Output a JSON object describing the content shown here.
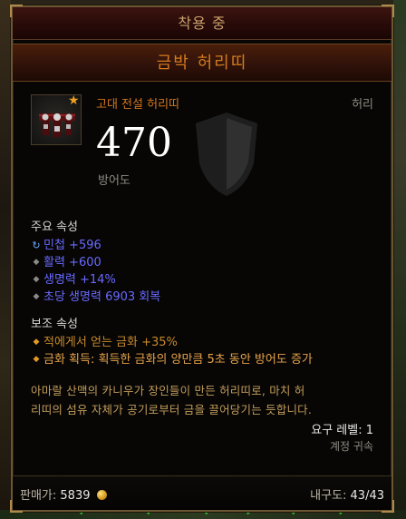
{
  "header": {
    "equipped_label": "착용 중",
    "item_name": "금박 허리띠"
  },
  "item": {
    "type_label": "고대 전설 허리띠",
    "slot_label": "허리",
    "armor_value": "470",
    "armor_label": "방어도",
    "icon": "belt-icon",
    "ancient_marker": "star-icon"
  },
  "primary": {
    "title": "주요 속성",
    "stats": [
      "민첩 +596",
      "활력 +600",
      "생명력 +14%",
      "초당 생명력 6903 회복"
    ]
  },
  "secondary": {
    "title": "보조 속성",
    "stats": [
      "적에게서 얻는 금화 +35%",
      "금화 획득: 획득한 금화의 양만큼 5초 동안 방어도 증가"
    ]
  },
  "flavor": {
    "line1": "아마랄 산맥의 카니우가 장인들이 만든 허리띠로, 마치 허",
    "line2": "리띠의 섬유 자체가 공기로부터 금을 끌어당기는 듯합니다."
  },
  "requirements": {
    "level": "요구 레벨: 1",
    "bind": "계정 귀속"
  },
  "footer": {
    "sell_label": "판매가:",
    "sell_value": "5839",
    "durability_label": "내구도:",
    "durability_value": "43/43"
  },
  "colors": {
    "legendary": "#d47a1e",
    "primary_stat": "#6969ff",
    "secondary_stat": "#c88a2a",
    "flavor": "#c29d5a"
  }
}
